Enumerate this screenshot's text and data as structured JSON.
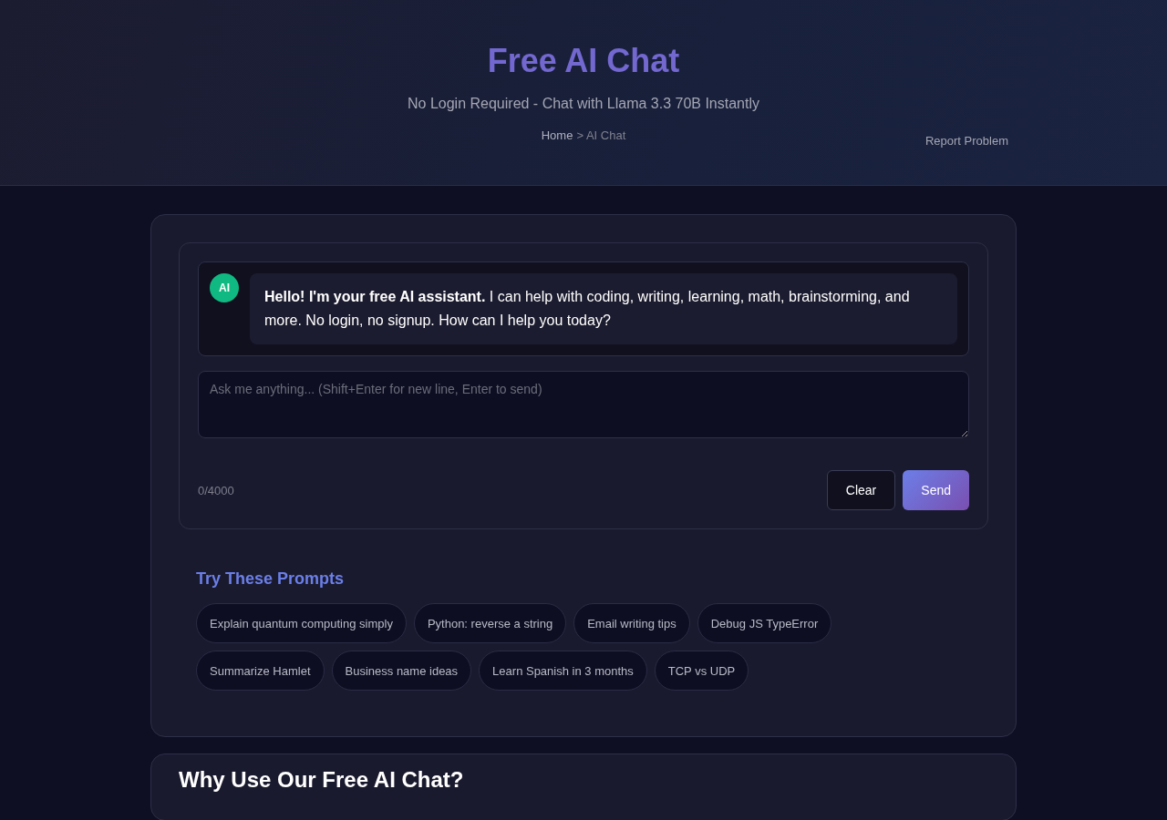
{
  "header": {
    "title": "Free AI Chat",
    "subtitle": "No Login Required - Chat with Llama 3.3 70B Instantly",
    "breadcrumb": {
      "home": "Home",
      "current": "> AI Chat"
    },
    "report_link": "Report Problem"
  },
  "chat": {
    "messages": [
      {
        "avatar": "AI",
        "text": "**Hello! I'm your free AI assistant.** I can help with coding, writing, learning, math, brainstorming, and more. No login, no signup. How can I help you today?"
      }
    ],
    "input": {
      "placeholder": "Ask me anything... (Shift+Enter for new line, Enter to send)"
    },
    "counter": "0/4000",
    "buttons": [
      {
        "label": "Clear",
        "kind": "secondary"
      },
      {
        "label": "Send",
        "kind": "primary"
      }
    ]
  },
  "prompts": {
    "title": "Try These Prompts",
    "items": [
      "Explain quantum computing simply",
      "Python: reverse a string",
      "Email writing tips",
      "Debug JS TypeError",
      "Summarize Hamlet",
      "Business name ideas",
      "Learn Spanish in 3 months",
      "TCP vs UDP"
    ]
  },
  "features": {
    "title": "Why Use Our Free AI Chat?"
  }
}
